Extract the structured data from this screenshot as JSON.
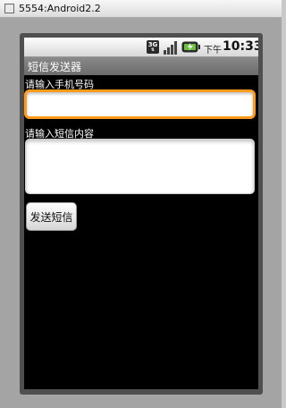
{
  "window": {
    "title": "5554:Android2.2",
    "controls": [
      "—",
      "□",
      "✕"
    ]
  },
  "statusbar": {
    "network_label": "3G",
    "ampm": "下午",
    "time": "10:33",
    "icons": [
      "3g-icon",
      "signal-icon",
      "battery-icon"
    ]
  },
  "app": {
    "title": "短信发送器",
    "phone_label": "请输入手机号码",
    "phone_value": "",
    "message_label": "请输入短信内容",
    "message_value": "",
    "send_button": "发送短信"
  },
  "colors": {
    "focus_border": "#ff9a1a",
    "screen_background": "#000000",
    "titlebar": "#7a7a7a"
  }
}
